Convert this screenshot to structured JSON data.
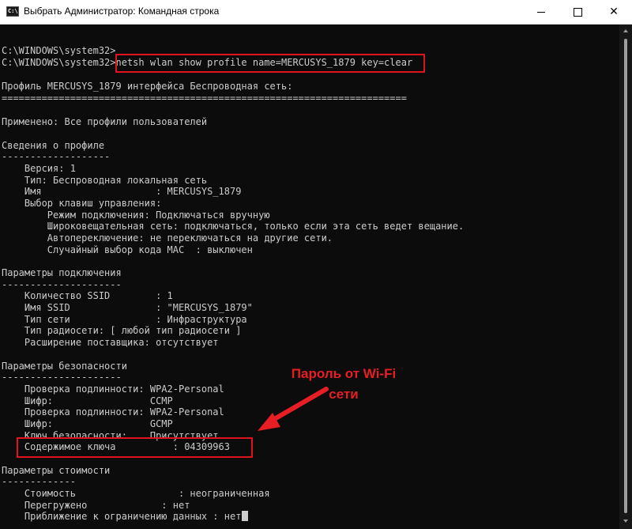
{
  "window": {
    "title": "Выбрать Администратор: Командная строка",
    "icon_name": "cmd-icon",
    "controls": {
      "minimize": "minimize-icon",
      "maximize": "maximize-icon",
      "close": "✕"
    }
  },
  "console": {
    "lines": [
      "C:\\WINDOWS\\system32>",
      "C:\\WINDOWS\\system32>netsh wlan show profile name=MERCUSYS_1879 key=clear",
      "",
      "Профиль MERCUSYS_1879 интерфейса Беспроводная сеть:",
      "=======================================================================",
      "",
      "Применено: Все профили пользователей",
      "",
      "Сведения о профиле",
      "-------------------",
      "    Версия: 1",
      "    Тип: Беспроводная локальная сеть",
      "    Имя                    : MERCUSYS_1879",
      "    Выбор клавиш управления:",
      "        Режим подключения: Подключаться вручную",
      "        Широковещательная сеть: подключаться, только если эта сеть ведет вещание.",
      "        Автопереключение: не переключаться на другие сети.",
      "        Случайный выбор кода MAC  : выключен",
      "",
      "Параметры подключения",
      "---------------------",
      "    Количество SSID        : 1",
      "    Имя SSID               : \"MERCUSYS_1879\"",
      "    Тип сети               : Инфраструктура",
      "    Тип радиосети: [ любой тип радиосети ]",
      "    Расширение поставщика: отсутствует",
      "",
      "Параметры безопасности",
      "---------------------",
      "    Проверка подлинности: WPA2-Personal",
      "    Шифр:                 CCMP",
      "    Проверка подлинности: WPA2-Personal",
      "    Шифр:                 GCMP",
      "    Ключ безопасности:    Присутствует",
      "    Содержимое ключа          : 04309963",
      "",
      "Параметры стоимости",
      "-------------",
      "    Стоимость                  : неограниченная",
      "    Перегружено             : нет",
      "    Приближение к ограничению данных : нет"
    ]
  },
  "annotation": {
    "line1": "Пароль от Wi-Fi",
    "line2": "сети",
    "color": "#e81e25"
  },
  "colors": {
    "console_bg": "#0c0c0c",
    "console_text": "#cccccc",
    "highlight": "#e0141e"
  }
}
